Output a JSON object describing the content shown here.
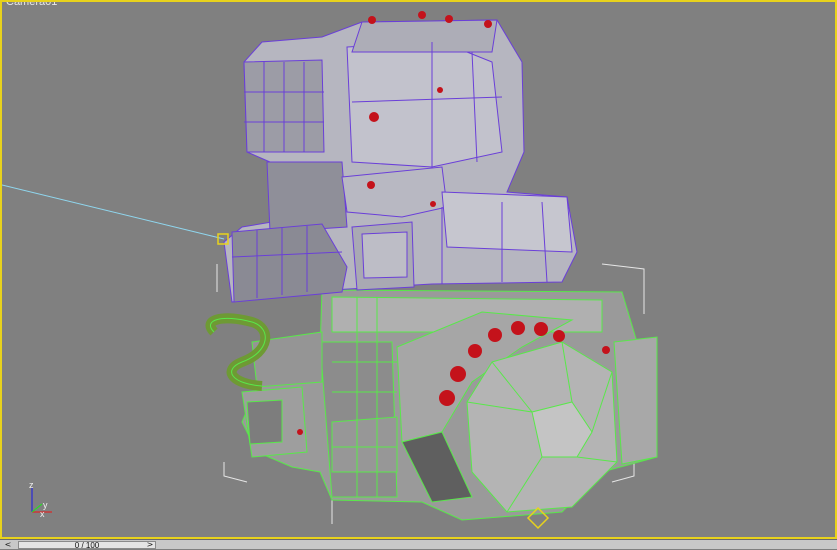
{
  "viewport": {
    "label": "Camera01"
  },
  "timebar": {
    "frame_readout": "0 / 100",
    "prev_glyph": "<",
    "next_glyph": ">"
  },
  "axis": {
    "z": "z",
    "x": "x",
    "y": "y"
  },
  "colors": {
    "background": "#808080",
    "active_border": "#e8d21c",
    "upper_wire": "#6a3fd8",
    "lower_wire": "#59e84a",
    "rivets": "#c4121b",
    "camera_line": "#8fd6ee"
  }
}
